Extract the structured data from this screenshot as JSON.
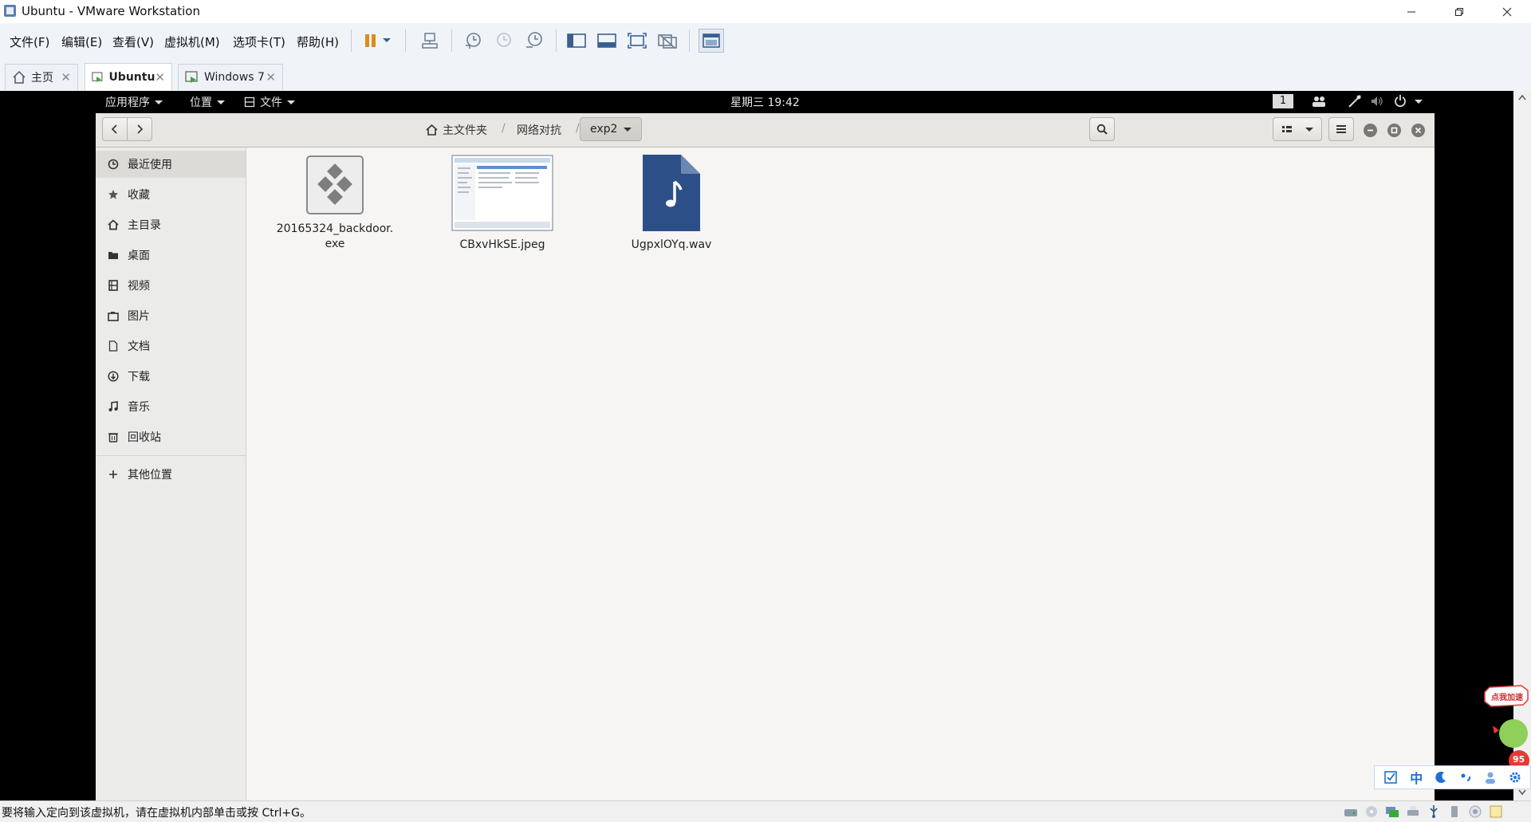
{
  "window": {
    "title": "Ubuntu - VMware Workstation"
  },
  "menu": [
    "文件(F)",
    "编辑(E)",
    "查看(V)",
    "虚拟机(M)",
    "选项卡(T)",
    "帮助(H)"
  ],
  "tabs": [
    {
      "label": "主页"
    },
    {
      "label": "Ubuntu"
    },
    {
      "label": "Windows 7"
    }
  ],
  "gnome": {
    "apps": "应用程序",
    "places": "位置",
    "files": "文件",
    "clock": "星期三 19:42",
    "workspace": "1"
  },
  "path": {
    "home": "主文件夹",
    "folder1": "网络对抗",
    "current": "exp2"
  },
  "sidebar": {
    "items": [
      {
        "label": "最近使用",
        "icon": "clock-icon"
      },
      {
        "label": "收藏",
        "icon": "star-icon"
      },
      {
        "label": "主目录",
        "icon": "home-icon"
      },
      {
        "label": "桌面",
        "icon": "folder-icon"
      },
      {
        "label": "视频",
        "icon": "film-icon"
      },
      {
        "label": "图片",
        "icon": "camera-icon"
      },
      {
        "label": "文档",
        "icon": "document-icon"
      },
      {
        "label": "下载",
        "icon": "download-icon"
      },
      {
        "label": "音乐",
        "icon": "music-icon"
      },
      {
        "label": "回收站",
        "icon": "trash-icon"
      }
    ],
    "other": "其他位置"
  },
  "files": [
    {
      "name": "20165324_backdoor.exe",
      "type": "executable"
    },
    {
      "name": "CBxvHkSE.jpeg",
      "type": "image"
    },
    {
      "name": "UgpxlOYq.wav",
      "type": "audio"
    }
  ],
  "status": {
    "message": "要将输入定向到该虚拟机，请在虚拟机内部单击或按 Ctrl+G。"
  },
  "ime": {
    "mode": "中"
  },
  "badge": {
    "speed_label": "点我加速",
    "percent": "95"
  },
  "colors": {
    "audio_icon": "#2c4f87",
    "pause_button": "#e08a1e"
  }
}
